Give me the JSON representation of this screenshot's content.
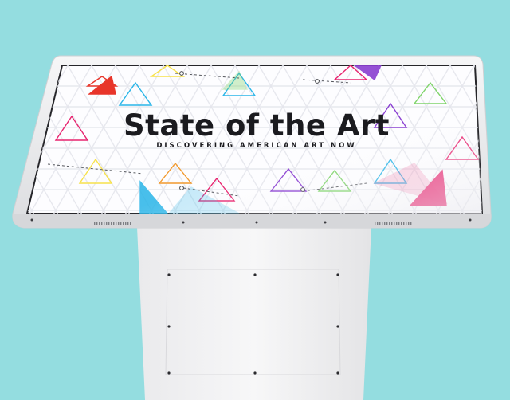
{
  "scene": {
    "background_color": "#94dde0",
    "bezel_color": "#ecedee",
    "stand_color": "#f2f2f3",
    "screen_background": "#ffffff"
  },
  "screen": {
    "title": "State of the Art",
    "subtitle": "DISCOVERING AMERICAN ART NOW",
    "title_color": "#1b1b1f",
    "accent_colors": [
      "#e8246f",
      "#f7e24b",
      "#29b5e8",
      "#8a3fd1",
      "#7fd46a",
      "#f29a2e",
      "#e8352a"
    ]
  }
}
